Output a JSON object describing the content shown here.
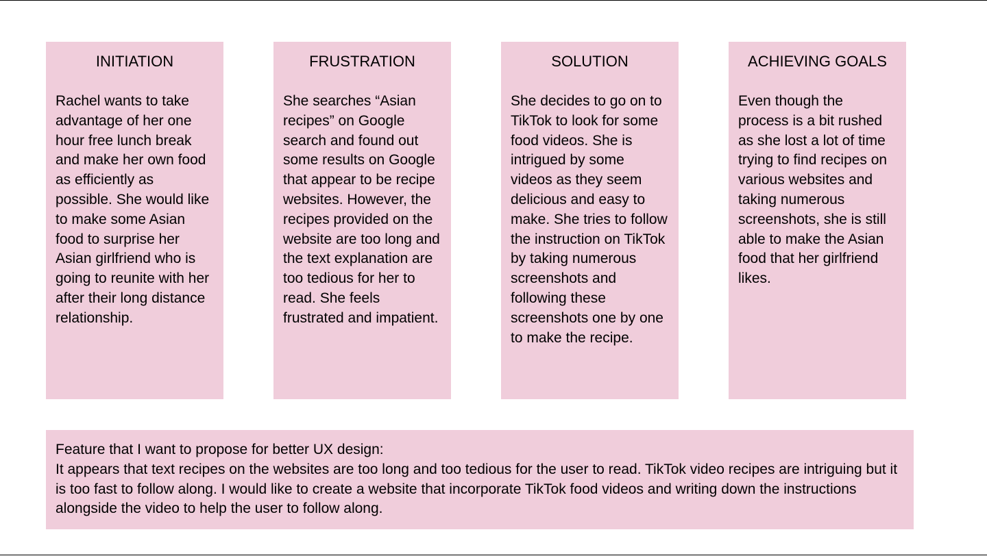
{
  "stages": [
    {
      "title": "INITIATION",
      "body": "Rachel wants to take advantage of her one hour free lunch break and make her own food as efficiently as possible. She would like to make some Asian food to surprise her Asian girlfriend who is going to reunite with her after their long distance relationship."
    },
    {
      "title": "FRUSTRATION",
      "body": "She searches “Asian recipes” on Google search and found out some results on Google that appear to be recipe websites. However, the recipes provided on the website are too long and the text explanation are too tedious for her to read. She feels frustrated and impatient."
    },
    {
      "title": "SOLUTION",
      "body": "She decides to go on to TikTok to look for some food videos. She is intrigued by some videos as they seem delicious and easy to make. She tries to follow the instruction on TikTok by taking numerous screenshots and following these screenshots one by one to make the recipe."
    },
    {
      "title": "ACHIEVING GOALS",
      "body": "Even though the process is a bit rushed as she lost a lot of time trying to find recipes on various websites and taking numerous screenshots, she is still able to make the Asian food that her girlfriend likes."
    }
  ],
  "proposal": {
    "heading": "Feature that I want to propose for better UX design:",
    "text": "It appears that text recipes on the websites are too long and too tedious for the user to read. TikTok video recipes are intriguing but it is too fast to follow along. I would like to create a website that incorporate TikTok food videos and writing down the instructions alongside the video to help the user to follow along."
  },
  "colors": {
    "card_background": "#f0cddb",
    "text": "#000000",
    "page_background": "#ffffff"
  }
}
